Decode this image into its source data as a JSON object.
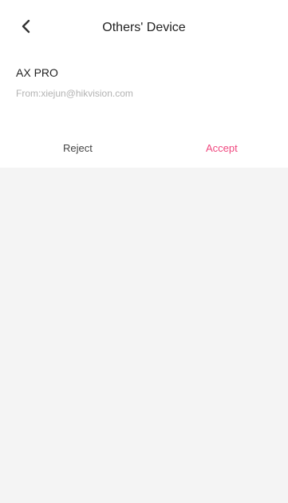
{
  "header": {
    "title": "Others' Device"
  },
  "device": {
    "name": "AX PRO",
    "from": "From:xiejun@hikvision.com"
  },
  "actions": {
    "reject_label": "Reject",
    "accept_label": "Accept"
  },
  "colors": {
    "accent": "#f0487f",
    "background": "#f4f4f4",
    "card": "#ffffff"
  },
  "icons": {
    "back": "chevron-left-icon"
  }
}
